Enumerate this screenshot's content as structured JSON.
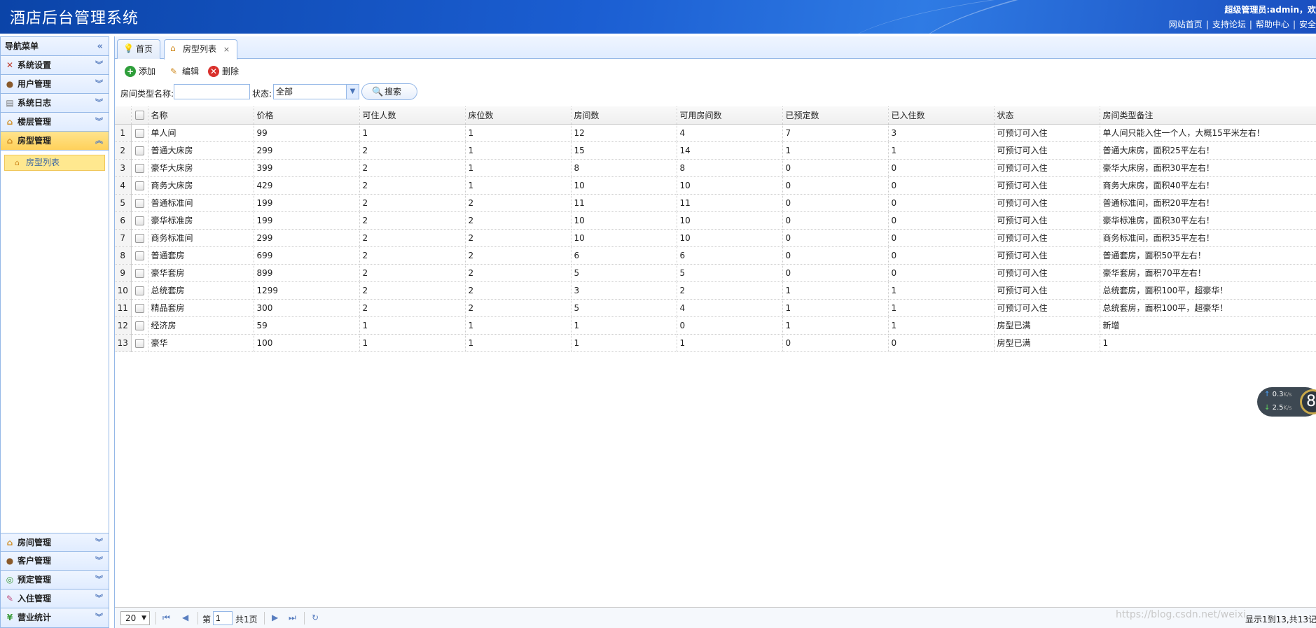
{
  "header": {
    "app_title": "酒店后台管理系统",
    "user_info": "超级管理员:admin，欢",
    "links": [
      "网站首页",
      "支持论坛",
      "帮助中心",
      "安全"
    ]
  },
  "sidebar": {
    "title": "导航菜单",
    "items": [
      {
        "label": "系统设置",
        "icon": "wrench-icon"
      },
      {
        "label": "用户管理",
        "icon": "users-icon"
      },
      {
        "label": "系统日志",
        "icon": "log-icon"
      },
      {
        "label": "楼层管理",
        "icon": "home-icon"
      },
      {
        "label": "房型管理",
        "icon": "home-icon"
      }
    ],
    "active_sub": {
      "label": "房型列表",
      "icon": "home-icon"
    },
    "bottom_items": [
      {
        "label": "房间管理",
        "icon": "home-icon"
      },
      {
        "label": "客户管理",
        "icon": "users-icon"
      },
      {
        "label": "预定管理",
        "icon": "booking-icon"
      },
      {
        "label": "入住管理",
        "icon": "checkin-icon"
      },
      {
        "label": "营业统计",
        "icon": "money-icon"
      }
    ]
  },
  "tabs": [
    {
      "label": "首页",
      "icon": "lightbulb-icon"
    },
    {
      "label": "房型列表",
      "icon": "home-icon",
      "close": "×"
    }
  ],
  "toolbar": {
    "add": "添加",
    "edit": "编辑",
    "delete": "删除"
  },
  "search": {
    "name_label": "房间类型名称:",
    "name_value": "",
    "status_label": "状态:",
    "status_value": "全部",
    "search_button": "搜索"
  },
  "table": {
    "columns": [
      "名称",
      "价格",
      "可住人数",
      "床位数",
      "房间数",
      "可用房间数",
      "已预定数",
      "已入住数",
      "状态",
      "房间类型备注"
    ],
    "rows": [
      {
        "n": "1",
        "cells": [
          "单人间",
          "99",
          "1",
          "1",
          "12",
          "4",
          "7",
          "3",
          "可预订可入住",
          "单人间只能入住一个人，大概15平米左右！"
        ]
      },
      {
        "n": "2",
        "cells": [
          "普通大床房",
          "299",
          "2",
          "1",
          "15",
          "14",
          "1",
          "1",
          "可预订可入住",
          "普通大床房，面积25平左右！"
        ]
      },
      {
        "n": "3",
        "cells": [
          "豪华大床房",
          "399",
          "2",
          "1",
          "8",
          "8",
          "0",
          "0",
          "可预订可入住",
          "豪华大床房，面积30平左右！"
        ]
      },
      {
        "n": "4",
        "cells": [
          "商务大床房",
          "429",
          "2",
          "1",
          "10",
          "10",
          "0",
          "0",
          "可预订可入住",
          "商务大床房，面积40平左右！"
        ]
      },
      {
        "n": "5",
        "cells": [
          "普通标准间",
          "199",
          "2",
          "2",
          "11",
          "11",
          "0",
          "0",
          "可预订可入住",
          "普通标准间，面积20平左右！"
        ]
      },
      {
        "n": "6",
        "cells": [
          "豪华标准房",
          "199",
          "2",
          "2",
          "10",
          "10",
          "0",
          "0",
          "可预订可入住",
          "豪华标准房，面积30平左右！"
        ]
      },
      {
        "n": "7",
        "cells": [
          "商务标准间",
          "299",
          "2",
          "2",
          "10",
          "10",
          "0",
          "0",
          "可预订可入住",
          "商务标准间，面积35平左右！"
        ]
      },
      {
        "n": "8",
        "cells": [
          "普通套房",
          "699",
          "2",
          "2",
          "6",
          "6",
          "0",
          "0",
          "可预订可入住",
          "普通套房，面积50平左右！"
        ]
      },
      {
        "n": "9",
        "cells": [
          "豪华套房",
          "899",
          "2",
          "2",
          "5",
          "5",
          "0",
          "0",
          "可预订可入住",
          "豪华套房，面积70平左右！"
        ]
      },
      {
        "n": "10",
        "cells": [
          "总统套房",
          "1299",
          "2",
          "2",
          "3",
          "2",
          "1",
          "1",
          "可预订可入住",
          "总统套房，面积100平，超豪华！"
        ]
      },
      {
        "n": "11",
        "cells": [
          "精品套房",
          "300",
          "2",
          "2",
          "5",
          "4",
          "1",
          "1",
          "可预订可入住",
          "总统套房，面积100平，超豪华！"
        ]
      },
      {
        "n": "12",
        "cells": [
          "经济房",
          "59",
          "1",
          "1",
          "1",
          "0",
          "1",
          "1",
          "房型已满",
          "新增"
        ]
      },
      {
        "n": "13",
        "cells": [
          "豪华",
          "100",
          "1",
          "1",
          "1",
          "1",
          "0",
          "0",
          "房型已满",
          "1"
        ]
      }
    ]
  },
  "pager": {
    "page_size": "20",
    "page_prefix": "第",
    "page_number": "1",
    "page_total": "共1页",
    "display_info": "显示1到13,共13记"
  },
  "watermark": "https://blog.csdn.net/weixi",
  "net_widget": {
    "up_value": "0.3",
    "down_value": "2.5",
    "unit": "K/s",
    "circle_text": "8"
  }
}
